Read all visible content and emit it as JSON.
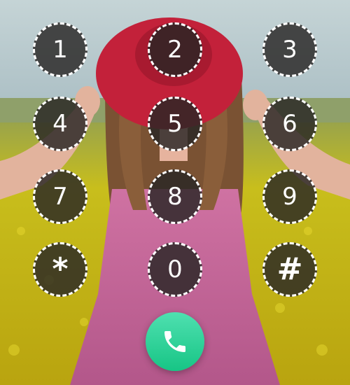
{
  "keypad": {
    "keys": [
      {
        "label": "1",
        "icon": "digit-1"
      },
      {
        "label": "2",
        "icon": "digit-2"
      },
      {
        "label": "3",
        "icon": "digit-3"
      },
      {
        "label": "4",
        "icon": "digit-4"
      },
      {
        "label": "5",
        "icon": "digit-5"
      },
      {
        "label": "6",
        "icon": "digit-6"
      },
      {
        "label": "7",
        "icon": "digit-7"
      },
      {
        "label": "8",
        "icon": "digit-8"
      },
      {
        "label": "9",
        "icon": "digit-9"
      },
      {
        "label": "*",
        "icon": "asterisk"
      },
      {
        "label": "0",
        "icon": "digit-0"
      },
      {
        "label": "#",
        "icon": "hash"
      }
    ],
    "call_icon": "phone-icon"
  },
  "colors": {
    "key_fill": "rgba(40,38,36,0.82)",
    "key_border": "#ffffff",
    "call_gradient_start": "#4fe0b0",
    "call_gradient_end": "#17c585",
    "sky": "#b9ccd2",
    "field": "#c9c01a",
    "dress": "#c06494",
    "hat": "#c3213a",
    "hair": "#7a5233"
  }
}
